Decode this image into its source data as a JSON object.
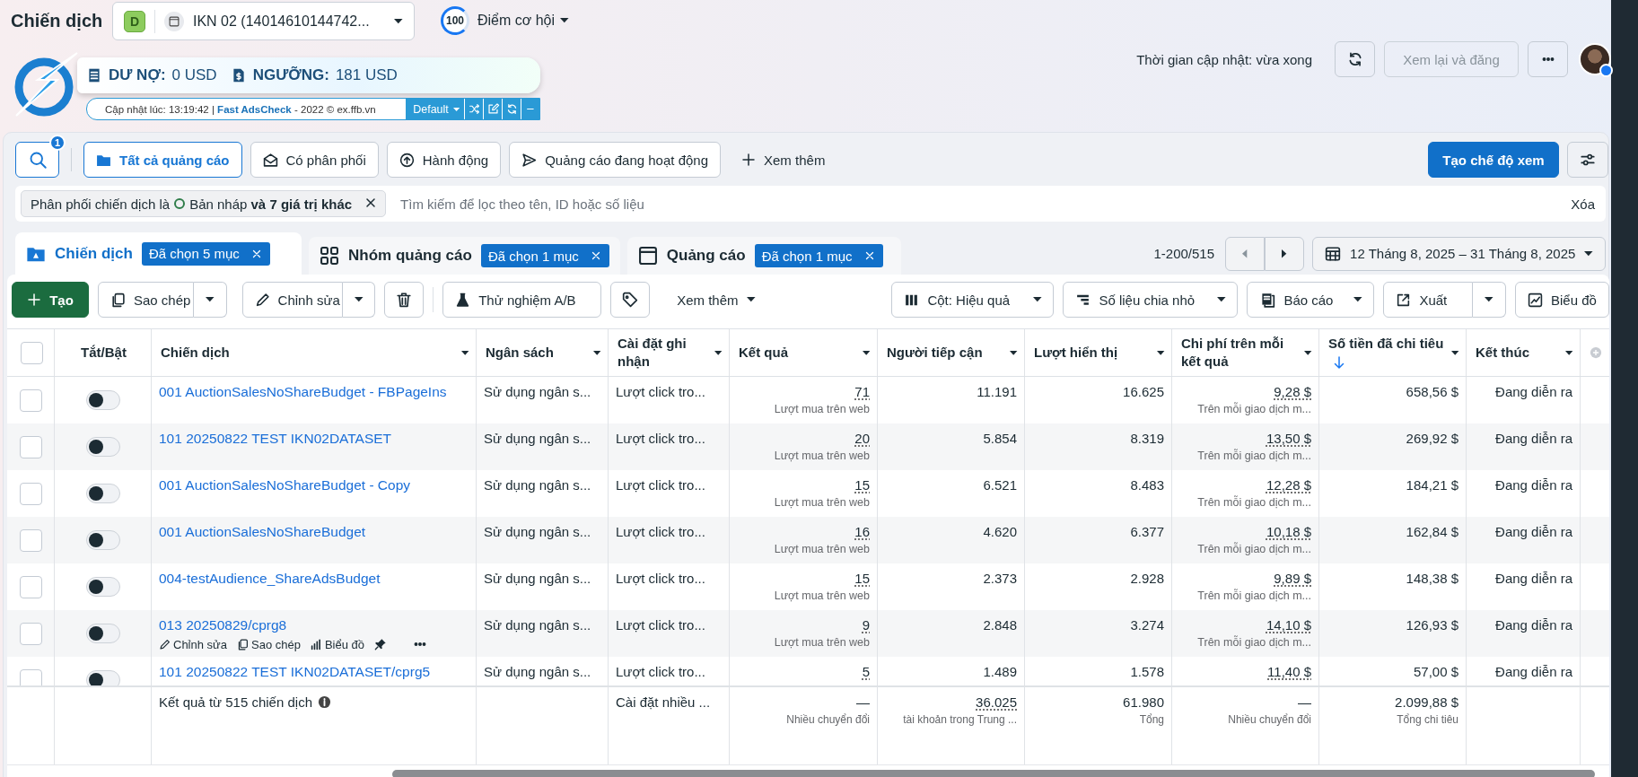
{
  "page_title": "Chiến dịch",
  "account_selector": {
    "badge": "D",
    "name": "IKN 02 (14014610144742..."
  },
  "opportunity": {
    "score": "100",
    "label": "Điểm cơ hội"
  },
  "adscheck": {
    "debt_label": "DƯ NỢ:",
    "debt": "0 USD",
    "threshold_label": "NGƯỠNG:",
    "threshold": "181 USD",
    "footer": "Cập nhật lúc: 13:19:42 | **Fast AdsCheck** - 2022 © ex.ffb.vn",
    "profile": "Default"
  },
  "header_right": {
    "update_time": "Thời gian cập nhật: vừa xong",
    "review_button": {
      "label": "Xem lại và đăng",
      "disabled": true
    }
  },
  "search_badge": "1",
  "view_filters": [
    {
      "label": "Tất cả quảng cáo",
      "selected": true
    },
    {
      "label": "Có phân phối",
      "selected": false
    },
    {
      "label": "Hành động",
      "selected": false
    },
    {
      "label": "Quảng cáo đang hoạt động",
      "selected": false
    }
  ],
  "more_filters": "Xem thêm",
  "create_view": "Tạo chế độ xem",
  "filter_chip": {
    "prefix": "Phân phối chiến dịch là",
    "value": "Bản nháp **và 7 giá trị khác**"
  },
  "search_placeholder": "Tìm kiếm để lọc theo tên, ID hoặc số liệu",
  "clear": "Xóa",
  "level_tabs": [
    {
      "label": "Chiến dịch",
      "chip": "Đã chọn 5 mục",
      "selected": true
    },
    {
      "label": "Nhóm quảng cáo",
      "chip": "Đã chọn 1 mục",
      "selected": false
    },
    {
      "label": "Quảng cáo",
      "chip": "Đã chọn 1 mục",
      "selected": false
    }
  ],
  "pagination": "1-200/515",
  "date_range": "12 Tháng 8, 2025 – 31 Tháng 8, 2025",
  "action_toolbar": {
    "create": "Tạo",
    "duplicate": "Sao chép",
    "edit": "Chỉnh sửa",
    "ab_test": "Thử nghiệm A/B",
    "more": "Xem thêm",
    "columns": "Cột: Hiệu quả",
    "breakdown": "Số liệu chia nhỏ",
    "reports": "Báo cáo",
    "export": "Xuất",
    "chart": "Biểu đồ"
  },
  "table": {
    "header_checked": false,
    "columns": [
      {
        "label": "Tắt/Bật",
        "sorted": false
      },
      {
        "label": "Chiến dịch",
        "sorted": false
      },
      {
        "label": "Ngân sách",
        "sorted": false
      },
      {
        "label": "Cài đặt ghi nhận",
        "sorted": false
      },
      {
        "label": "Kết quả",
        "sorted": false
      },
      {
        "label": "Người tiếp cận",
        "sorted": false
      },
      {
        "label": "Lượt hiển thị",
        "sorted": false
      },
      {
        "label": "Chi phí trên mỗi kết quả",
        "sorted": false
      },
      {
        "label": "Số tiền đã chi tiêu",
        "sorted": true
      },
      {
        "label": "Kết thúc",
        "sorted": false
      }
    ],
    "rows": [
      {
        "checked": false,
        "on": false,
        "name": "001 AuctionSalesNoShareBudget - FBPageIns",
        "budget": "Sử dụng ngân s...",
        "attribution": "Lượt click tro...",
        "result": {
          "value": "71",
          "sub": "Lượt mua trên web"
        },
        "reach": "11.191",
        "impressions": "16.625",
        "cost": {
          "value": "9,28 $",
          "sub": "Trên mỗi giao dịch m..."
        },
        "spent": "658,56 $",
        "end": "Đang diễn ra"
      },
      {
        "checked": false,
        "on": false,
        "name": "101 20250822 TEST IKN02DATASET",
        "budget": "Sử dụng ngân s...",
        "attribution": "Lượt click tro...",
        "result": {
          "value": "20",
          "sub": "Lượt mua trên web"
        },
        "reach": "5.854",
        "impressions": "8.319",
        "cost": {
          "value": "13,50 $",
          "sub": "Trên mỗi giao dịch m..."
        },
        "spent": "269,92 $",
        "end": "Đang diễn ra"
      },
      {
        "checked": false,
        "on": false,
        "name": "001 AuctionSalesNoShareBudget - Copy",
        "budget": "Sử dụng ngân s...",
        "attribution": "Lượt click tro...",
        "result": {
          "value": "15",
          "sub": "Lượt mua trên web"
        },
        "reach": "6.521",
        "impressions": "8.483",
        "cost": {
          "value": "12,28 $",
          "sub": "Trên mỗi giao dịch m..."
        },
        "spent": "184,21 $",
        "end": "Đang diễn ra"
      },
      {
        "checked": false,
        "on": false,
        "name": "001 AuctionSalesNoShareBudget",
        "budget": "Sử dụng ngân s...",
        "attribution": "Lượt click tro...",
        "result": {
          "value": "16",
          "sub": "Lượt mua trên web"
        },
        "reach": "4.620",
        "impressions": "6.377",
        "cost": {
          "value": "10,18 $",
          "sub": "Trên mỗi giao dịch m..."
        },
        "spent": "162,84 $",
        "end": "Đang diễn ra"
      },
      {
        "checked": false,
        "on": false,
        "name": "004-testAudience_ShareAdsBudget",
        "budget": "Sử dụng ngân s...",
        "attribution": "Lượt click tro...",
        "result": {
          "value": "15",
          "sub": "Lượt mua trên web"
        },
        "reach": "2.373",
        "impressions": "2.928",
        "cost": {
          "value": "9,89 $",
          "sub": "Trên mỗi giao dịch m..."
        },
        "spent": "148,38 $",
        "end": "Đang diễn ra"
      },
      {
        "checked": false,
        "on": false,
        "name": "013 20250829/cprg8",
        "hover_actions": [
          "Chỉnh sửa",
          "Sao chép",
          "Biểu đồ"
        ],
        "budget": "Sử dụng ngân s...",
        "attribution": "Lượt click tro...",
        "result": {
          "value": "9",
          "sub": "Lượt mua trên web"
        },
        "reach": "2.848",
        "impressions": "3.274",
        "cost": {
          "value": "14,10 $",
          "sub": "Trên mỗi giao dịch m..."
        },
        "spent": "126,93 $",
        "end": "Đang diễn ra"
      },
      {
        "checked": false,
        "on": false,
        "name": "101 20250822 TEST IKN02DATASET/cprg5",
        "budget": "Sử dụng ngân s...",
        "attribution": "Lượt click tro...",
        "result": {
          "value": "5"
        },
        "reach": "1.489",
        "impressions": "1.578",
        "cost": {
          "value": "11,40 $"
        },
        "spent": "57,00 $",
        "end": "Đang diễn ra"
      }
    ],
    "totals": {
      "label": "Kết quả từ 515 chiến dịch",
      "attribution": "Cài đặt nhiều ...",
      "result": {
        "value": "—",
        "sub": "Nhiều chuyển đổi"
      },
      "reach": {
        "value": "36.025",
        "sub": "tài khoản trong Trung ..."
      },
      "impressions": {
        "value": "61.980",
        "sub": "Tổng"
      },
      "cost": {
        "value": "—",
        "sub": "Nhiều chuyển đổi"
      },
      "spent": {
        "value": "2.099,88 $",
        "sub": "Tổng chi tiêu"
      }
    }
  }
}
